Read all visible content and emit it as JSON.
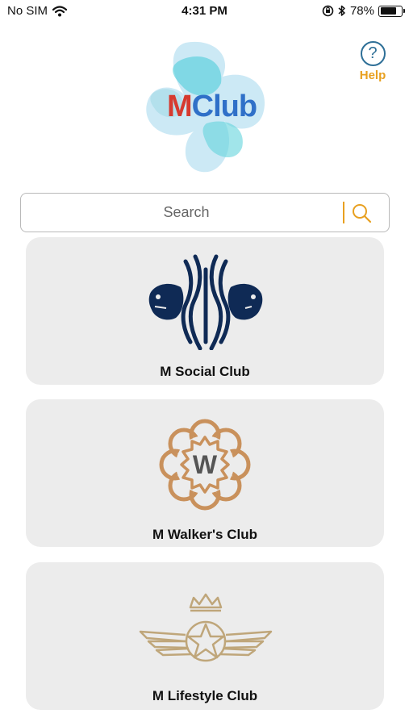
{
  "status_bar": {
    "carrier": "No SIM",
    "time": "4:31 PM",
    "battery_percent": "78%",
    "battery_level": 0.78
  },
  "header": {
    "help_label": "Help",
    "help_glyph": "?",
    "logo_text": "MClub"
  },
  "search": {
    "placeholder": "Search"
  },
  "clubs": [
    {
      "name": "M Social Club",
      "icon": "lion-emblem-icon"
    },
    {
      "name": "M Walker's Club",
      "icon": "w-badge-icon"
    },
    {
      "name": "M Lifestyle Club",
      "icon": "crowned-star-wings-icon"
    }
  ],
  "colors": {
    "accent": "#e8a020",
    "help_blue": "#2e6f97",
    "card_bg": "#ececec",
    "navy": "#0f2a55",
    "bronze": "#c9915c",
    "gold": "#bfa67a"
  }
}
